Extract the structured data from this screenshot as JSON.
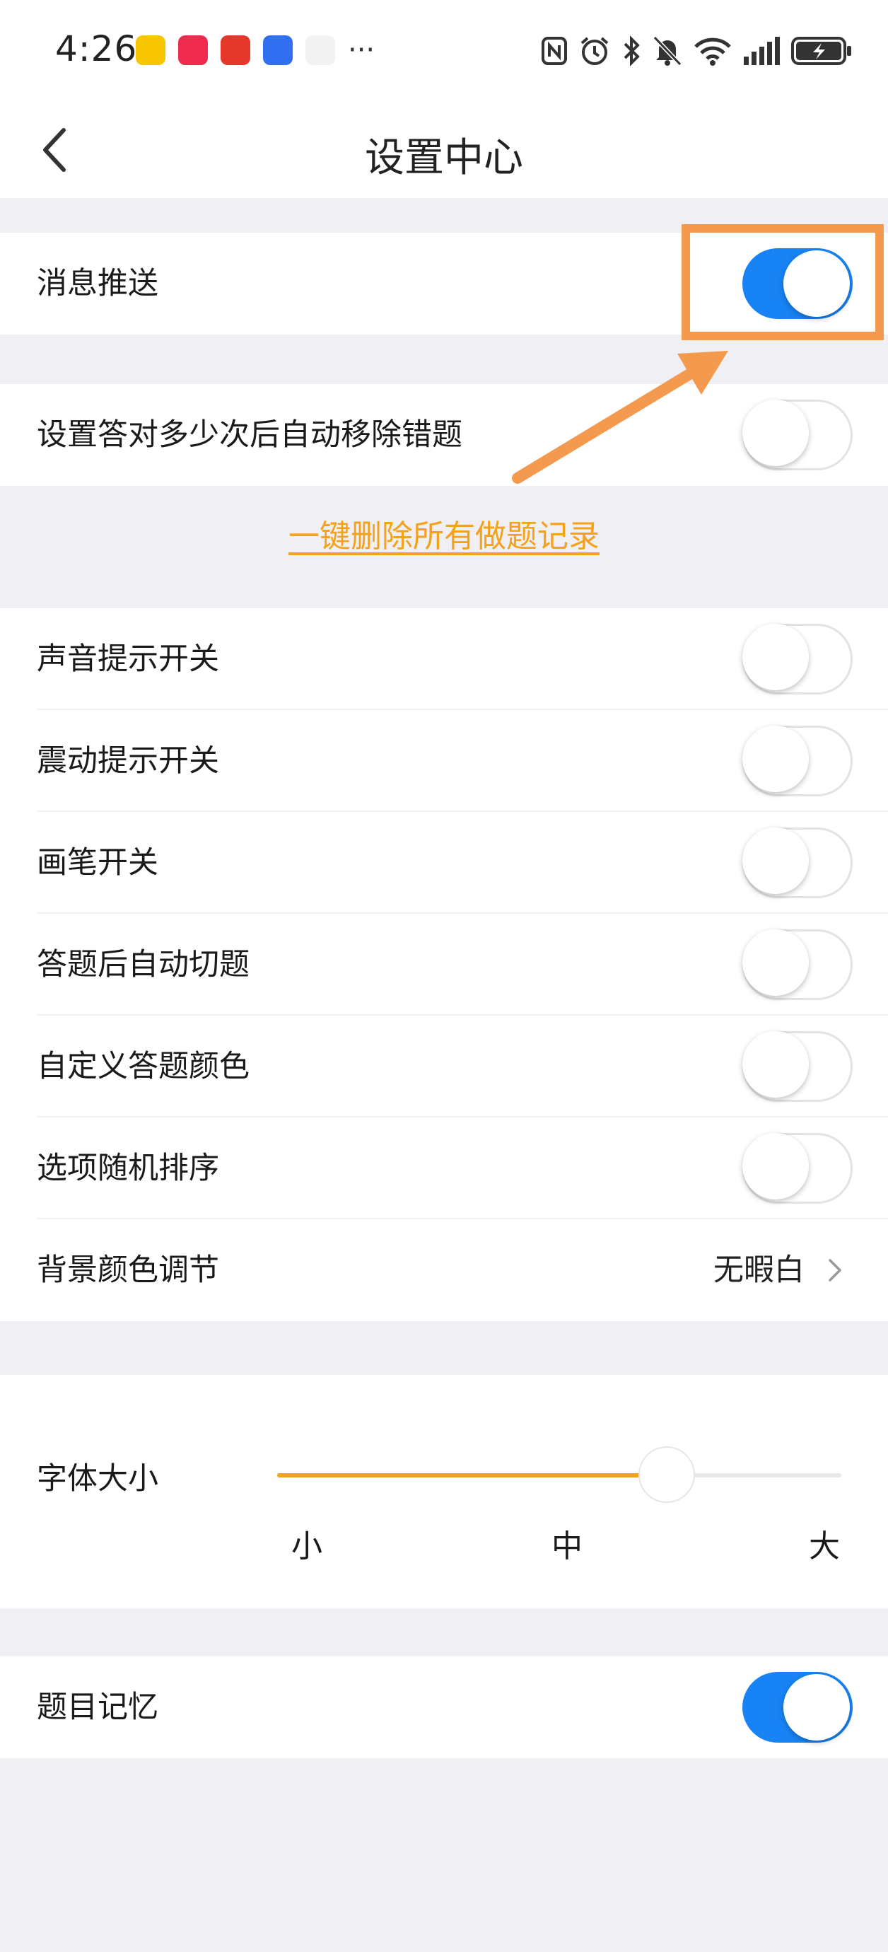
{
  "status_bar": {
    "time": "4:26",
    "app_icons": [
      "app-icon-1",
      "xiaohongshu-icon",
      "app-icon-3",
      "app-icon-4",
      "app-icon-5"
    ],
    "more": "···",
    "system_icons": [
      "nfc-icon",
      "alarm-icon",
      "bluetooth-icon",
      "mute-icon",
      "wifi-icon",
      "signal-icon",
      "battery-icon"
    ]
  },
  "header": {
    "title": "设置中心"
  },
  "settings": {
    "push": {
      "label": "消息推送",
      "on": true
    },
    "auto_remove": {
      "label": "设置答对多少次后自动移除错题",
      "on": false
    },
    "delete_link": "一键删除所有做题记录",
    "sound": {
      "label": "声音提示开关",
      "on": false
    },
    "vibrate": {
      "label": "震动提示开关",
      "on": false
    },
    "pen": {
      "label": "画笔开关",
      "on": false
    },
    "auto_next": {
      "label": "答题后自动切题",
      "on": false
    },
    "custom_color": {
      "label": "自定义答题颜色",
      "on": false
    },
    "shuffle": {
      "label": "选项随机排序",
      "on": false
    },
    "bg_color": {
      "label": "背景颜色调节",
      "value": "无暇白"
    },
    "font_size": {
      "label": "字体大小",
      "levels": [
        "小",
        "中",
        "大"
      ],
      "position": 0.69
    },
    "memory": {
      "label": "题目记忆",
      "on": true
    }
  },
  "colors": {
    "accent": "#1883f4",
    "link": "#f5a21b",
    "annotation": "#f49a4f"
  }
}
